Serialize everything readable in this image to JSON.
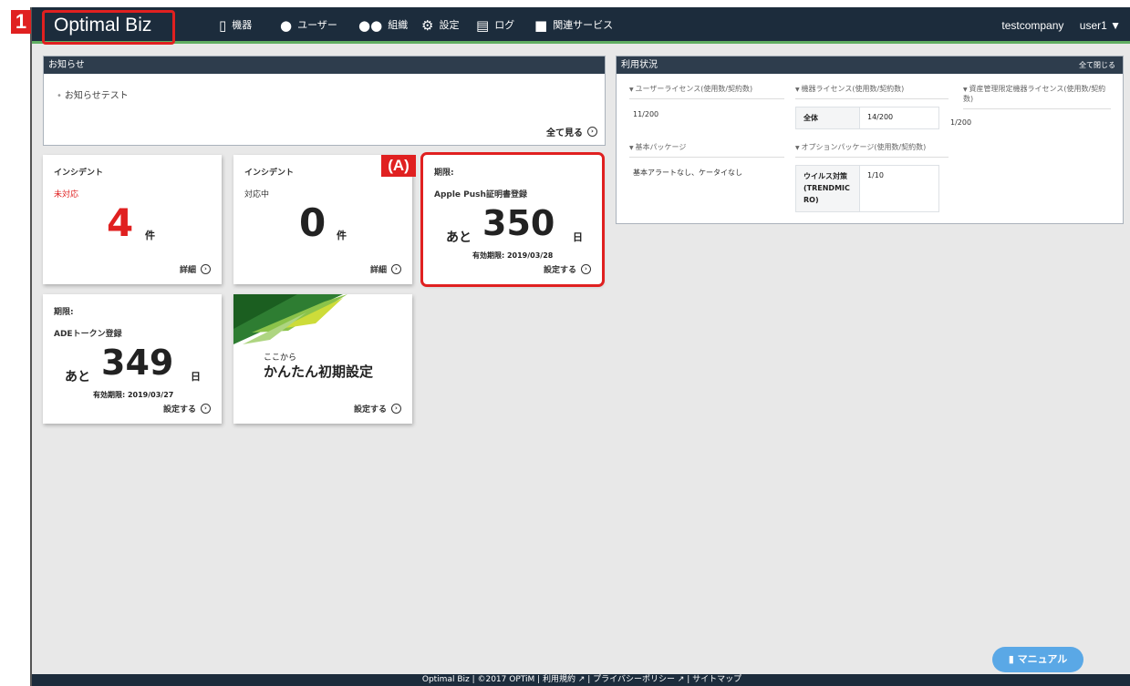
{
  "header": {
    "logo": "Optimal Biz",
    "nav": [
      {
        "label": "機器",
        "icon": "device-icon"
      },
      {
        "label": "ユーザー",
        "icon": "user-icon"
      },
      {
        "label": "組織",
        "icon": "group-icon"
      },
      {
        "label": "設定",
        "icon": "gear-icon"
      },
      {
        "label": "ログ",
        "icon": "document-icon"
      },
      {
        "label": "関連サービス",
        "icon": "folder-icon"
      }
    ],
    "company": "testcompany",
    "user": "user1 ▼"
  },
  "annotations": {
    "tag1": "1",
    "tagA": "(A)"
  },
  "notice": {
    "title": "お知らせ",
    "item": "お知らせテスト",
    "more": "全て見る"
  },
  "usage": {
    "title": "利用状況",
    "collapse": "全て閉じる",
    "user_license": {
      "label": "ユーザーライセンス(使用数/契約数)",
      "value": "11/200"
    },
    "device_license": {
      "label": "機器ライセンス(使用数/契約数)",
      "row_label": "全体",
      "row_value": "14/200"
    },
    "asset_license": {
      "label": "資産管理限定機器ライセンス(使用数/契約数)",
      "value": "1/200"
    },
    "basic_package": {
      "label": "基本パッケージ",
      "value": "基本アラートなし、ケータイなし"
    },
    "option_package": {
      "label": "オプションパッケージ(使用数/契約数)",
      "row_label": "ウイルス対策(TRENDMICRO)",
      "row_value": "1/10"
    }
  },
  "cards": {
    "incident_open": {
      "title": "インシデント",
      "status": "未対応",
      "count": "4",
      "unit": "件",
      "link": "詳細"
    },
    "incident_progress": {
      "title": "インシデント",
      "status": "対応中",
      "count": "0",
      "unit": "件",
      "link": "詳細"
    },
    "apple_push": {
      "title": "期限:",
      "name": "Apple Push証明書登録",
      "prefix": "あと",
      "days": "350",
      "unit": "日",
      "expiry": "有効期限: 2019/03/28",
      "link": "設定する"
    },
    "ade_token": {
      "title": "期限:",
      "name": "ADEトークン登録",
      "prefix": "あと",
      "days": "349",
      "unit": "日",
      "expiry": "有効期限: 2019/03/27",
      "link": "設定する"
    },
    "easy_setup": {
      "small": "ここから",
      "title": "かんたん初期設定",
      "link": "設定する"
    }
  },
  "footer": "Optimal Biz | ©2017 OPTiM | 利用規約 ↗ | プライバシーポリシー ↗ | サイトマップ",
  "manual_button": "マニュアル",
  "colors": {
    "nav": "#1c2c3c",
    "accent_green": "#5fae62",
    "alert_red": "#e02020",
    "manual_blue": "#5aa8e6"
  }
}
